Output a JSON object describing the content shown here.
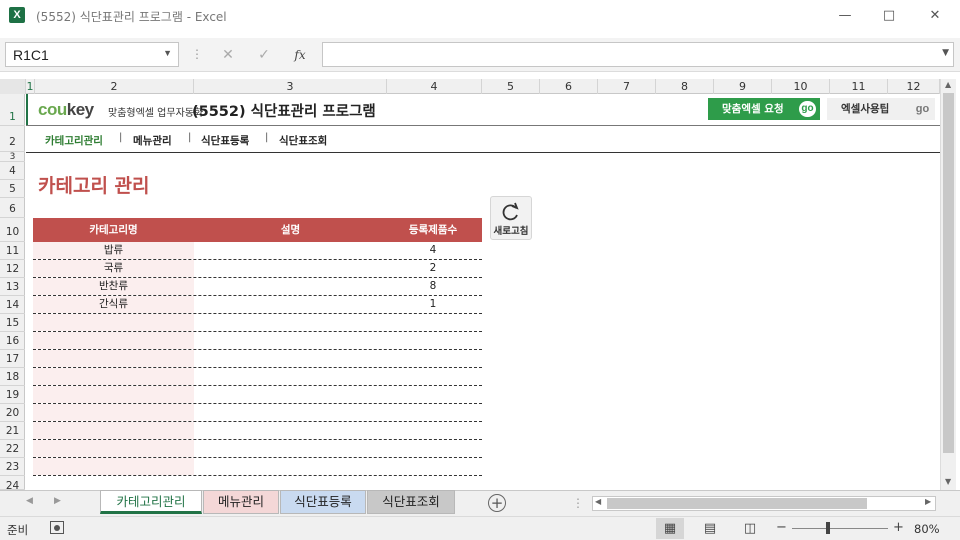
{
  "window": {
    "title": "(5552) 식단표관리 프로그램 - Excel",
    "app_icon": "X"
  },
  "formula_bar": {
    "name_box": "R1C1",
    "fx_label": "fx",
    "value": ""
  },
  "columns": [
    "1",
    "2",
    "3",
    "4",
    "5",
    "6",
    "7",
    "8",
    "9",
    "10",
    "11",
    "12"
  ],
  "rows": [
    "1",
    "2",
    "3",
    "4",
    "5",
    "6",
    "10",
    "11",
    "12",
    "13",
    "14",
    "15",
    "16",
    "17",
    "18",
    "19",
    "20",
    "21",
    "22",
    "23",
    "24"
  ],
  "header": {
    "logo_a": "cou",
    "logo_b": "key",
    "logo_sub": "맞춤형엑셀 업무자동화",
    "title": "(5552)  식단표관리 프로그램",
    "request_button": "맞춤엑셀 요청",
    "tips_button": "엑셀사용팁",
    "go": "go"
  },
  "nav": {
    "items": [
      "카테고리관리",
      "메뉴관리",
      "식단표등록",
      "식단표조회"
    ],
    "separator": "|"
  },
  "page": {
    "heading": "카테고리 관리",
    "refresh_label": "새로고침"
  },
  "table": {
    "headers": [
      "카테고리명",
      "설명",
      "등록제품수"
    ],
    "rows": [
      {
        "name": "밥류",
        "desc": "",
        "count": "4"
      },
      {
        "name": "국류",
        "desc": "",
        "count": "2"
      },
      {
        "name": "반찬류",
        "desc": "",
        "count": "8"
      },
      {
        "name": "간식류",
        "desc": "",
        "count": "1"
      },
      {
        "name": "",
        "desc": "",
        "count": ""
      },
      {
        "name": "",
        "desc": "",
        "count": ""
      },
      {
        "name": "",
        "desc": "",
        "count": ""
      },
      {
        "name": "",
        "desc": "",
        "count": ""
      },
      {
        "name": "",
        "desc": "",
        "count": ""
      },
      {
        "name": "",
        "desc": "",
        "count": ""
      },
      {
        "name": "",
        "desc": "",
        "count": ""
      },
      {
        "name": "",
        "desc": "",
        "count": ""
      },
      {
        "name": "",
        "desc": "",
        "count": ""
      }
    ]
  },
  "sheet_tabs": [
    {
      "label": "카테고리관리",
      "active": true,
      "color": "#ffffff"
    },
    {
      "label": "메뉴관리",
      "active": false,
      "color": "#f4d7d7"
    },
    {
      "label": "식단표등록",
      "active": false,
      "color": "#c9daf0"
    },
    {
      "label": "식단표조회",
      "active": false,
      "color": "#c8c8c8"
    }
  ],
  "status": {
    "ready": "준비",
    "zoom": "80%",
    "zoom_minus": "−",
    "zoom_plus": "+"
  },
  "colors": {
    "accent_red": "#c0504d",
    "excel_green": "#1e7145",
    "go_green": "#2e9c4a"
  }
}
